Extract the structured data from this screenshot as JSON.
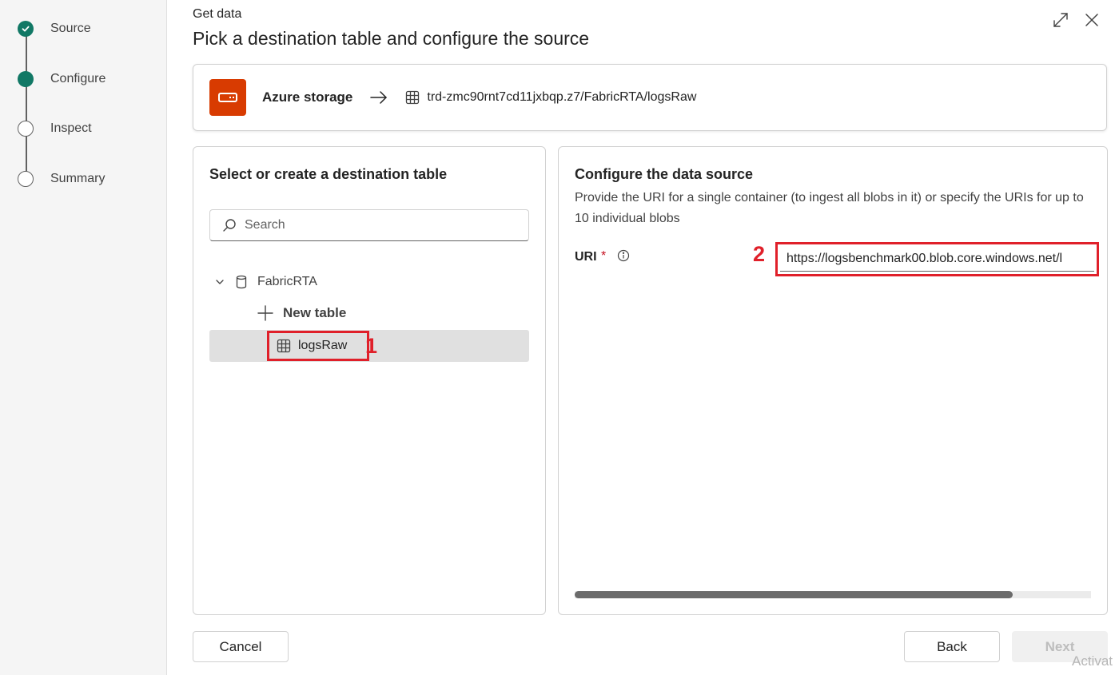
{
  "stepper": {
    "steps": [
      {
        "label": "Source",
        "state": "done"
      },
      {
        "label": "Configure",
        "state": "active"
      },
      {
        "label": "Inspect",
        "state": "pending"
      },
      {
        "label": "Summary",
        "state": "pending"
      }
    ]
  },
  "header": {
    "subtitle": "Get data",
    "title": "Pick a destination table and configure the source",
    "icons": [
      "expand-icon",
      "close-icon"
    ]
  },
  "source_card": {
    "source_icon": "storage-icon",
    "source_name": "Azure storage",
    "arrow_icon": "arrow-right-icon",
    "dest_icon": "table-icon",
    "dest_path": "trd-zmc90rnt7cd11jxbqp.z7/FabricRTA/logsRaw"
  },
  "left_panel": {
    "title": "Select or create a destination table",
    "search": {
      "placeholder": "Search",
      "value": ""
    },
    "tree": {
      "database": "FabricRTA",
      "new_table_label": "New table",
      "selected_table": "logsRaw"
    },
    "callout": "1"
  },
  "right_panel": {
    "title": "Configure the data source",
    "description": "Provide the URI for a single container (to ingest all blobs in it) or specify the URIs for up to 10 individual blobs",
    "uri_label": "URI",
    "uri_required_mark": "*",
    "uri_value": "https://logsbenchmark00.blob.core.windows.net/l",
    "callout": "2"
  },
  "footer": {
    "cancel_label": "Cancel",
    "back_label": "Back",
    "next_label": "Next",
    "watermark": "Activat"
  },
  "colors": {
    "step_active": "#117865",
    "storage_icon_bg": "#d83b01",
    "highlight": "#e0202a"
  }
}
